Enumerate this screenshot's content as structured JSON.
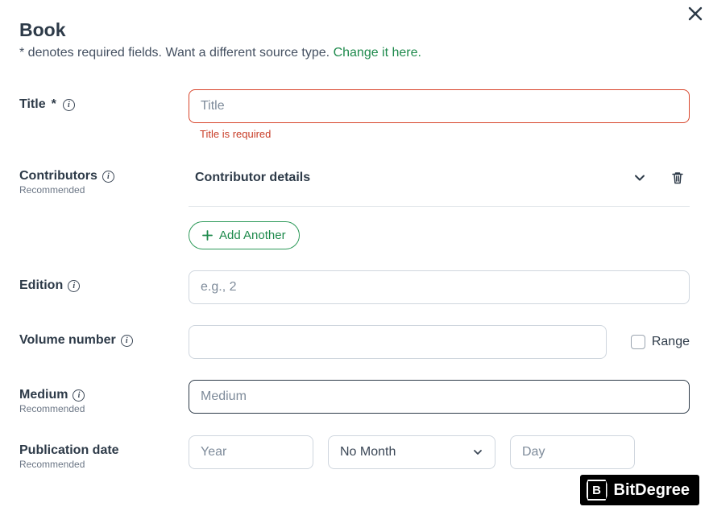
{
  "header": {
    "title": "Book",
    "subtitle_prefix": "* denotes required fields. Want a different source type. ",
    "change_link": "Change it here."
  },
  "title_field": {
    "label": "Title",
    "required_mark": "*",
    "placeholder": "Title",
    "error": "Title is required"
  },
  "contributors": {
    "label": "Contributors",
    "hint": "Recommended",
    "row_label": "Contributor details",
    "add_button": "Add Another"
  },
  "edition": {
    "label": "Edition",
    "placeholder": "e.g., 2"
  },
  "volume": {
    "label": "Volume number",
    "range_label": "Range"
  },
  "medium": {
    "label": "Medium",
    "hint": "Recommended",
    "placeholder": "Medium"
  },
  "pub_date": {
    "label": "Publication date",
    "hint": "Recommended",
    "year_placeholder": "Year",
    "month_value": "No Month",
    "day_placeholder": "Day"
  },
  "watermark": {
    "logo_letter": "B",
    "text": "BitDegree"
  }
}
